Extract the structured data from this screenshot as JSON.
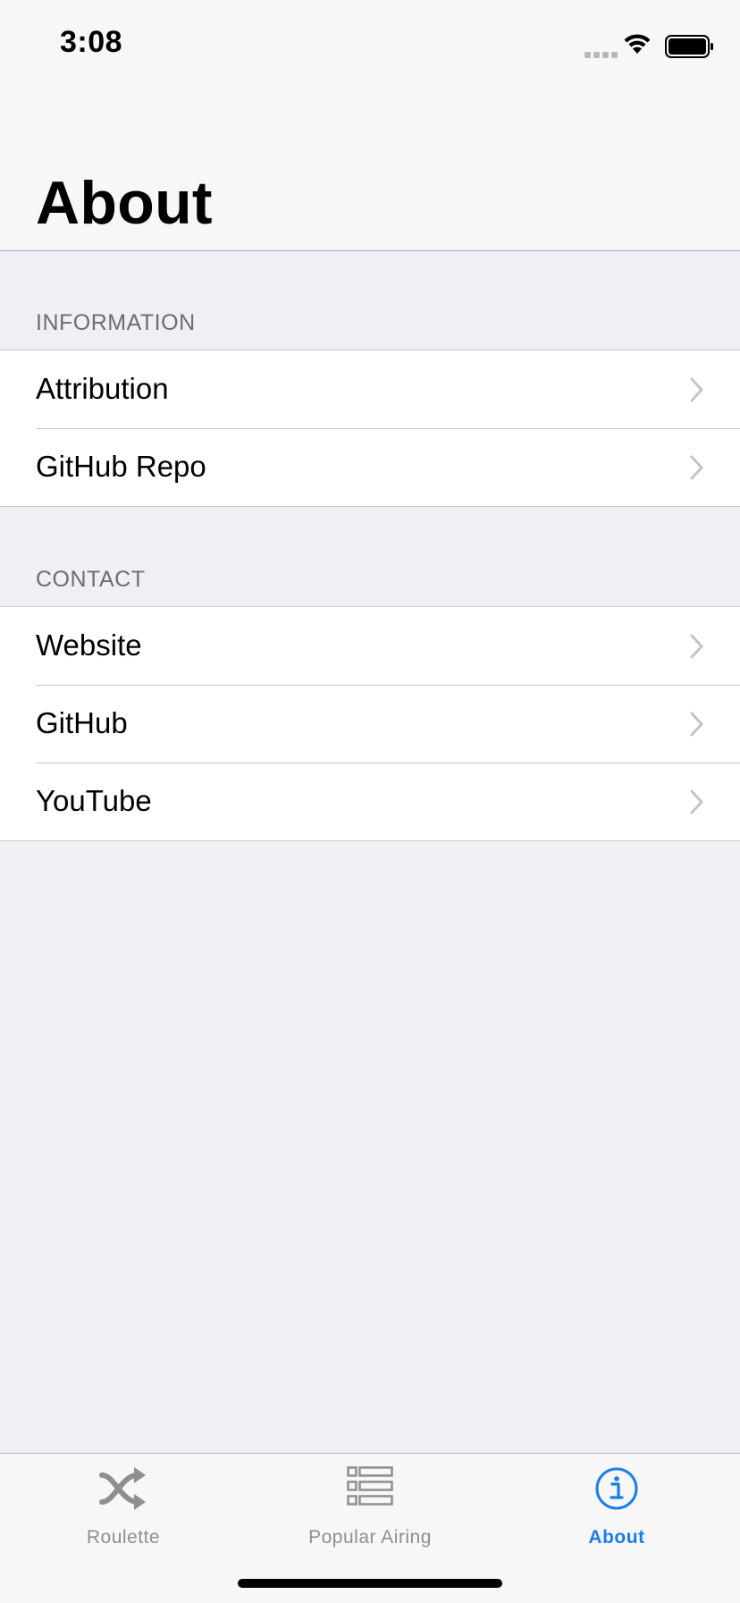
{
  "status_bar": {
    "time": "3:08"
  },
  "nav": {
    "title": "About"
  },
  "sections": [
    {
      "header": "INFORMATION",
      "items": [
        "Attribution",
        "GitHub Repo"
      ]
    },
    {
      "header": "CONTACT",
      "items": [
        "Website",
        "GitHub",
        "YouTube"
      ]
    }
  ],
  "tab_bar": {
    "tabs": [
      {
        "label": "Roulette",
        "icon": "shuffle-icon",
        "active": false
      },
      {
        "label": "Popular Airing",
        "icon": "list-icon",
        "active": false
      },
      {
        "label": "About",
        "icon": "info-icon",
        "active": true
      }
    ]
  },
  "colors": {
    "accent": "#1a7ee6",
    "inactive_tab": "#8e8e93",
    "background": "#efeff4",
    "section_header": "#6d6d72"
  }
}
